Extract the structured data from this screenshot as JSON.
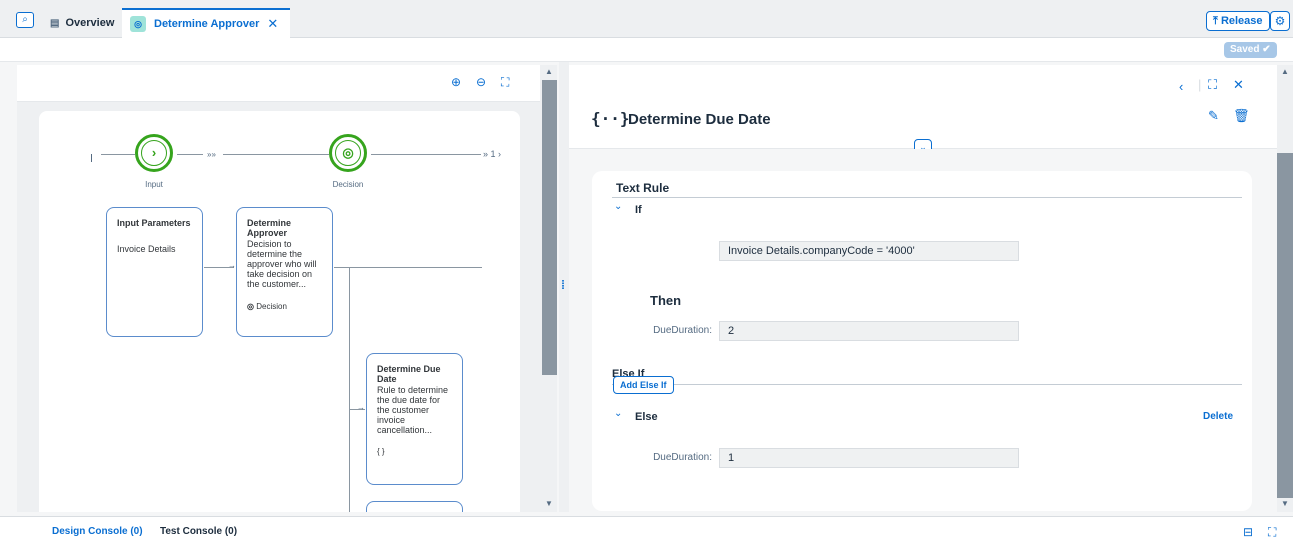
{
  "tabs": {
    "overview_label": "Overview",
    "active_label": "Determine Approver"
  },
  "header": {
    "release_label": "Release",
    "saved_label": "Saved"
  },
  "flow": {
    "input_label": "Input",
    "decision_label": "Decision",
    "chevrons_left": "»»",
    "chevrons_right": "» 1 ›"
  },
  "cards": {
    "input_params": {
      "title": "Input Parameters",
      "item": "Invoice Details"
    },
    "determine_approver": {
      "title": "Determine Approver",
      "desc": "Decision to determine the approver who will take decision on the customer...",
      "type": "Decision"
    },
    "determine_due_date": {
      "title": "Determine Due Date",
      "desc": "Rule to determine the due date for the customer invoice cancellation...",
      "type": "{ }"
    }
  },
  "rule": {
    "title_icon": "{··}",
    "title": "Determine Due Date",
    "text_rule_label": "Text Rule",
    "if_label": "If",
    "if_condition": "Invoice Details.companyCode = '4000'",
    "then_label": "Then",
    "then_field_label": "DueDuration:",
    "then_value": "2",
    "else_if_label": "Else If",
    "add_else_if_label": "Add Else If",
    "else_label": "Else",
    "delete_label": "Delete",
    "else_field_label": "DueDuration:",
    "else_value": "1"
  },
  "console": {
    "design_label": "Design Console (0)",
    "test_label": "Test Console (0)"
  },
  "colors": {
    "accent": "#0a6ed1",
    "success": "#36a41d"
  }
}
